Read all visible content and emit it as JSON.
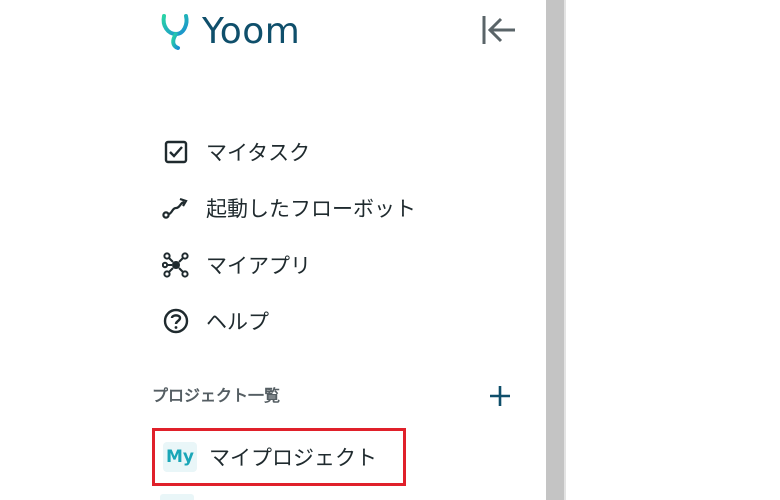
{
  "brand": {
    "name": "Yoom"
  },
  "nav": {
    "items": [
      {
        "label": "マイタスク",
        "icon": "checkbox-icon"
      },
      {
        "label": "起動したフローボット",
        "icon": "flow-icon"
      },
      {
        "label": "マイアプリ",
        "icon": "network-icon"
      },
      {
        "label": "ヘルプ",
        "icon": "help-icon"
      }
    ]
  },
  "projects": {
    "section_title": "プロジェクト一覧",
    "items": [
      {
        "badge": "My",
        "label": "マイプロジェクト"
      }
    ]
  },
  "colors": {
    "brand_text": "#0f4f6b",
    "brand_accent": "#22c0b8",
    "add_button": "#0f4f6b",
    "highlight_border": "#e0202a",
    "badge_text": "#1aa6b7"
  }
}
